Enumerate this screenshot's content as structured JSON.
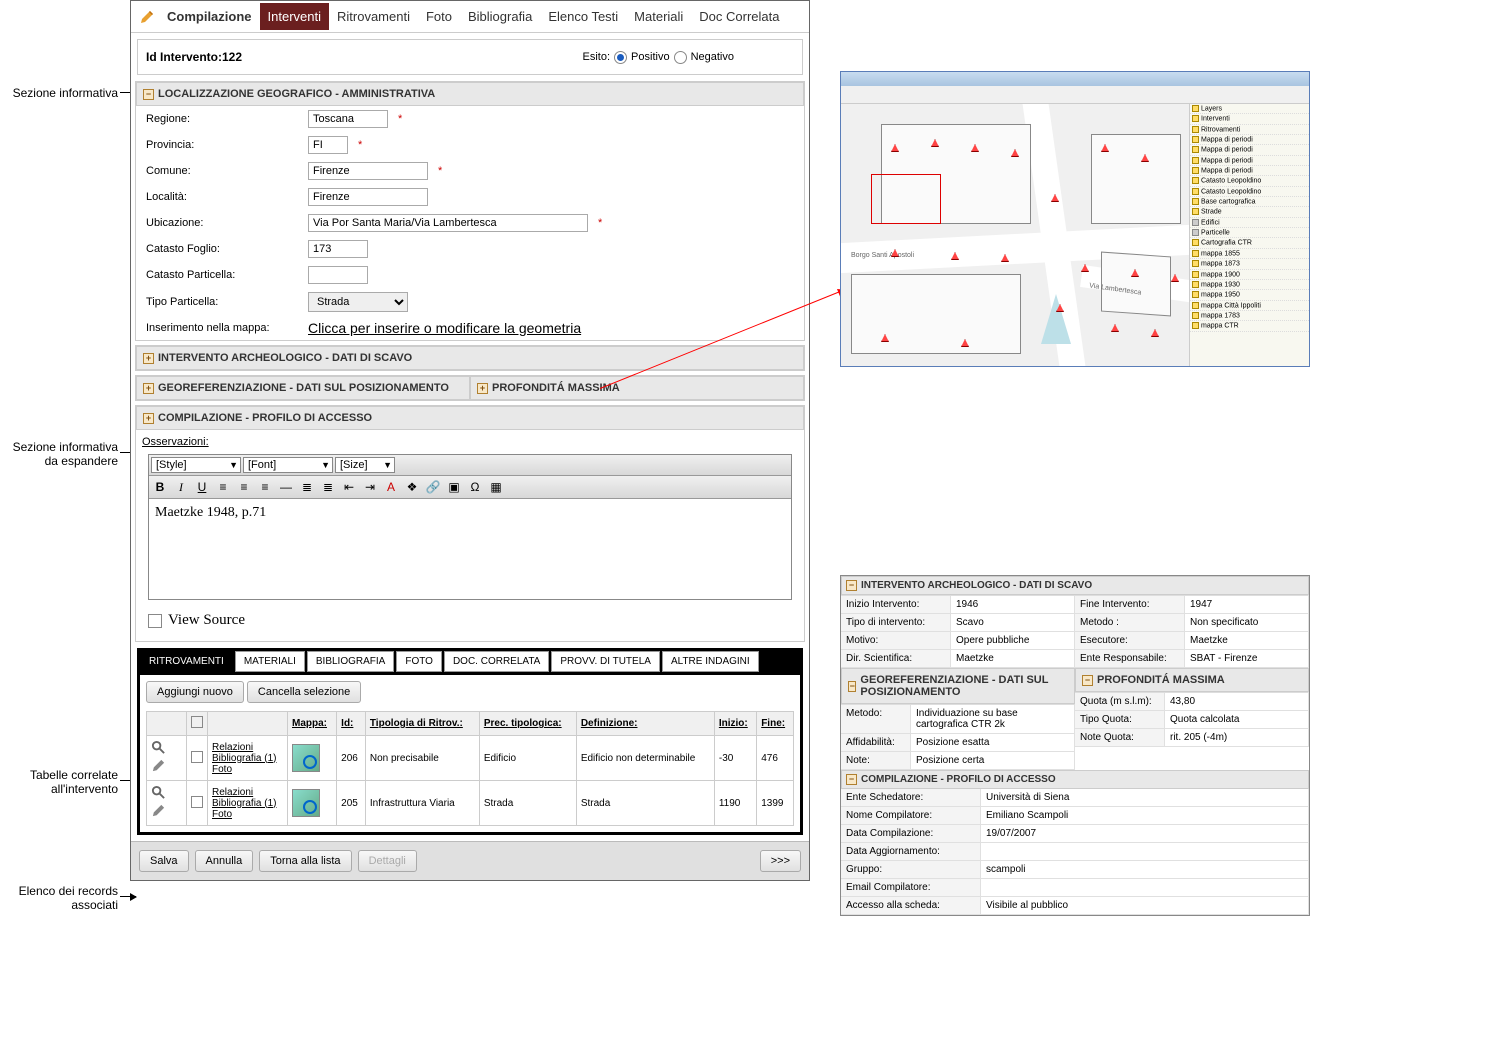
{
  "annotations": {
    "sezione_informativa": "Sezione informativa",
    "sezione_espandere_l1": "Sezione informativa",
    "sezione_espandere_l2": "da espandere",
    "tabelle_correlate_l1": "Tabelle correlate",
    "tabelle_correlate_l2": "all'intervento",
    "elenco_records_l1": "Elenco dei records",
    "elenco_records_l2": "associati"
  },
  "main_tabs": {
    "compilazione": "Compilazione",
    "interventi": "Interventi",
    "ritrovamenti": "Ritrovamenti",
    "foto": "Foto",
    "bibliografia": "Bibliografia",
    "elenco_testi": "Elenco Testi",
    "materiali": "Materiali",
    "doc_correlata": "Doc Correlata"
  },
  "id_bar": {
    "id_label": "Id Intervento:122",
    "esito": "Esito:",
    "positivo": "Positivo",
    "negativo": "Negativo"
  },
  "sec_loc": "LOCALIZZAZIONE GEOGRAFICO - AMMINISTRATIVA",
  "form": {
    "regione": {
      "label": "Regione:",
      "value": "Toscana"
    },
    "provincia": {
      "label": "Provincia:",
      "value": "FI"
    },
    "comune": {
      "label": "Comune:",
      "value": "Firenze"
    },
    "localita": {
      "label": "Località:",
      "value": "Firenze"
    },
    "ubicazione": {
      "label": "Ubicazione:",
      "value": "Via Por Santa Maria/Via Lambertesca"
    },
    "catasto_foglio": {
      "label": "Catasto Foglio:",
      "value": "173"
    },
    "catasto_particella": {
      "label": "Catasto Particella:",
      "value": ""
    },
    "tipo_particella": {
      "label": "Tipo Particella:",
      "value": "Strada"
    },
    "inserimento_mappa": {
      "label": "Inserimento nella mappa:",
      "link": "Clicca per inserire o modificare la geometria"
    }
  },
  "sec_arch": "INTERVENTO ARCHEOLOGICO - DATI DI SCAVO",
  "sec_georef": "GEOREFERENZIAZIONE - DATI SUL POSIZIONAMENTO",
  "sec_prof": "PROFONDITÁ MASSIMA",
  "sec_comp": "COMPILAZIONE - PROFILO DI ACCESSO",
  "editor": {
    "osservazioni": "Osservazioni:",
    "style": "[Style]",
    "font": "[Font]",
    "size": "[Size]",
    "content": "Maetzke 1948, p.71",
    "view_source": "View Source"
  },
  "sub_tabs": {
    "ritrovamenti": "RITROVAMENTI",
    "materiali": "MATERIALI",
    "bibliografia": "BIBLIOGRAFIA",
    "foto": "FOTO",
    "doc_correlata": "DOC. CORRELATA",
    "provv_tutela": "PROVV. DI TUTELA",
    "altre_indagini": "ALTRE INDAGINI"
  },
  "sub_buttons": {
    "aggiungi": "Aggiungi nuovo",
    "cancella": "Cancella selezione"
  },
  "table": {
    "headers": {
      "mappa": "Mappa:",
      "id": "Id:",
      "tipologia": "Tipologia di Ritrov.:",
      "prec": "Prec. tipologica:",
      "definizione": "Definizione:",
      "inizio": "Inizio:",
      "fine": "Fine:"
    },
    "rel": {
      "relazioni": "Relazioni",
      "bibliografia": "Bibliografia (1)",
      "foto": "Foto"
    },
    "rows": [
      {
        "id": "206",
        "tipologia": "Non precisabile",
        "prec": "Edificio",
        "definizione": "Edificio non determinabile",
        "inizio": "-30",
        "fine": "476"
      },
      {
        "id": "205",
        "tipologia": "Infrastruttura Viaria",
        "prec": "Strada",
        "definizione": "Strada",
        "inizio": "1190",
        "fine": "1399"
      }
    ]
  },
  "bottom": {
    "salva": "Salva",
    "annulla": "Annulla",
    "torna": "Torna alla lista",
    "dettagli": "Dettagli",
    "next": ">>>"
  },
  "rp_arch": {
    "inizio_intervento_k": "Inizio Intervento:",
    "inizio_intervento_v": "1946",
    "fine_intervento_k": "Fine Intervento:",
    "fine_intervento_v": "1947",
    "tipo_intervento_k": "Tipo di intervento:",
    "tipo_intervento_v": "Scavo",
    "metodo_k": "Metodo :",
    "metodo_v": "Non specificato",
    "motivo_k": "Motivo:",
    "motivo_v": "Opere pubbliche",
    "esecutore_k": "Esecutore:",
    "esecutore_v": "Maetzke",
    "dir_k": "Dir. Scientifica:",
    "dir_v": "Maetzke",
    "ente_k": "Ente Responsabile:",
    "ente_v": "SBAT - Firenze"
  },
  "rp_georef": {
    "metodo_k": "Metodo:",
    "metodo_v": "Individuazione su base cartografica CTR 2k",
    "affid_k": "Affidabilità:",
    "affid_v": "Posizione esatta",
    "note_k": "Note:",
    "note_v": "Posizione certa"
  },
  "rp_prof": {
    "quota_k": "Quota (m s.l.m):",
    "quota_v": "43,80",
    "tipo_quota_k": "Tipo Quota:",
    "tipo_quota_v": "Quota calcolata",
    "note_quota_k": "Note Quota:",
    "note_quota_v": "rit. 205 (-4m)"
  },
  "rp_comp": {
    "ente_k": "Ente Schedatore:",
    "ente_v": "Università di Siena",
    "nome_k": "Nome Compilatore:",
    "nome_v": "Emiliano Scampoli",
    "data_comp_k": "Data Compilazione:",
    "data_comp_v": "19/07/2007",
    "data_agg_k": "Data Aggiornamento:",
    "data_agg_v": "",
    "gruppo_k": "Gruppo:",
    "gruppo_v": "scampoli",
    "email_k": "Email Compilatore:",
    "email_v": "",
    "accesso_k": "Accesso alla scheda:",
    "accesso_v": "Visibile al pubblico"
  },
  "map_streets": {
    "borgo": "Borgo Santi Apostoli",
    "lambertesca": "Via Lambertesca"
  }
}
